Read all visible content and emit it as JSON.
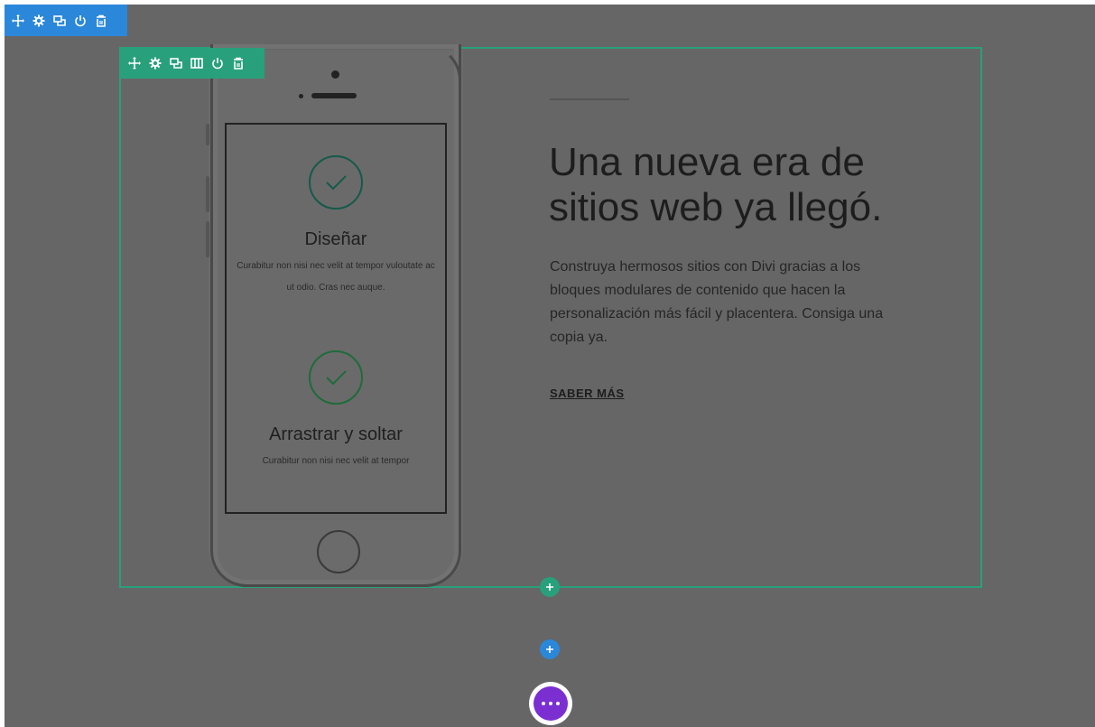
{
  "section_toolbar": {
    "icons": [
      "move-icon",
      "gear-icon",
      "duplicate-icon",
      "power-icon",
      "trash-icon"
    ],
    "color": "#2b87da"
  },
  "row_toolbar": {
    "icons": [
      "move-icon",
      "gear-icon",
      "duplicate-icon",
      "columns-icon",
      "power-icon",
      "trash-icon"
    ],
    "color": "#29a07c"
  },
  "phone": {
    "features": [
      {
        "title": "Diseñar",
        "text": "Curabitur non nisi nec velit at tempor vuloutate ac ut odio. Cras nec auque."
      },
      {
        "title": "Arrastrar y soltar",
        "text": "Curabitur non nisi nec velit at tempor"
      }
    ]
  },
  "hero": {
    "headline": "Una nueva era de sitios web ya llegó.",
    "body": "Construya hermosos sitios con Divi gracias a los bloques modulares de contenido que hacen la personalización más fácil y placentera. Consiga una copia ya.",
    "cta": "SABER MÁS"
  },
  "controls": {
    "add_row_icon": "plus-icon",
    "add_section_icon": "plus-icon",
    "more_icon": "ellipsis-icon",
    "more_color": "#7b2fd0"
  }
}
